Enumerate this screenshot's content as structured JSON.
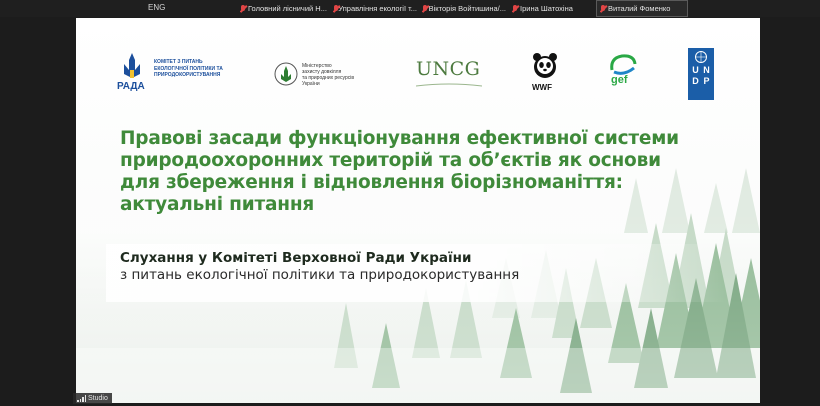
{
  "topbar": {
    "language": "ENG",
    "participants": [
      {
        "name": "Головний лісничий Н..."
      },
      {
        "name": "Управління екології т..."
      },
      {
        "name": "Вікторія Войтишина/..."
      },
      {
        "name": "Ірина Шатохіна"
      },
      {
        "name": "Виталий Фоменко"
      }
    ]
  },
  "slide": {
    "logos": {
      "rada_name": "РАДА",
      "rada_committee_line1": "КОМІТЕТ З ПИТАНЬ",
      "rada_committee_line2": "ЕКОЛОГІЧНОЇ ПОЛІТИКИ ТА",
      "rada_committee_line3": "ПРИРОДОКОРИСТУВАННЯ",
      "ministry_line1": "Міністерство",
      "ministry_line2": "захисту довкілля",
      "ministry_line3": "та природних ресурсів",
      "ministry_line4": "України",
      "uncg": "UNCG",
      "wwf": "WWF",
      "gef": "gef",
      "undp": [
        "U",
        "N",
        "D",
        "P"
      ]
    },
    "title_lines": [
      "Правові засади функціонування ефективної системи",
      "природоохоронних територій та об’єктів як основи",
      "для збереження і відновлення біорізноманіття:",
      "актуальні питання"
    ],
    "hearing_line1": "Слухання у Комітеті Верховної Ради України",
    "hearing_line2": "з питань екологічної політики та природокористування"
  },
  "status": {
    "studio_label": "Studio"
  }
}
